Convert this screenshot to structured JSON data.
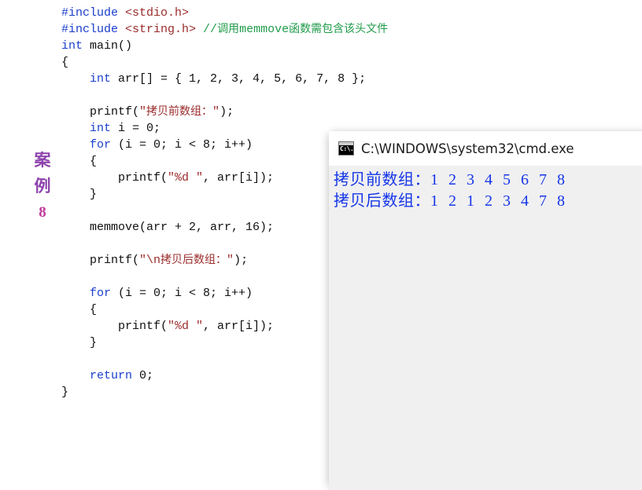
{
  "margin_caption": {
    "chars": [
      "案",
      "例"
    ],
    "number": "8",
    "char_color": "#8e44ad",
    "number_color": "#c0399b"
  },
  "code": {
    "language": "c",
    "lines": [
      [
        {
          "t": "#include ",
          "c": "pre"
        },
        {
          "t": "<stdio.h>",
          "c": "hdr"
        }
      ],
      [
        {
          "t": "#include ",
          "c": "pre"
        },
        {
          "t": "<string.h>",
          "c": "hdr"
        },
        {
          "t": " ",
          "c": "plain"
        },
        {
          "t": "//调用memmove函数需包含该头文件",
          "c": "cmt"
        }
      ],
      [
        {
          "t": "int",
          "c": "kw"
        },
        {
          "t": " main()",
          "c": "plain"
        }
      ],
      [
        {
          "t": "{",
          "c": "plain"
        }
      ],
      [
        {
          "t": "    ",
          "c": "plain"
        },
        {
          "t": "int",
          "c": "kw"
        },
        {
          "t": " arr[] = { 1, 2, 3, 4, 5, 6, 7, 8 };",
          "c": "plain"
        }
      ],
      [
        {
          "t": "",
          "c": "plain"
        }
      ],
      [
        {
          "t": "    printf(",
          "c": "plain"
        },
        {
          "t": "\"拷贝前数组：\"",
          "c": "str"
        },
        {
          "t": ");",
          "c": "plain"
        }
      ],
      [
        {
          "t": "    ",
          "c": "plain"
        },
        {
          "t": "int",
          "c": "kw"
        },
        {
          "t": " i = 0;",
          "c": "plain"
        }
      ],
      [
        {
          "t": "    ",
          "c": "plain"
        },
        {
          "t": "for",
          "c": "kw"
        },
        {
          "t": " (i = 0; i < 8; i++)",
          "c": "plain"
        }
      ],
      [
        {
          "t": "    {",
          "c": "plain"
        }
      ],
      [
        {
          "t": "        printf(",
          "c": "plain"
        },
        {
          "t": "\"%d \"",
          "c": "str"
        },
        {
          "t": ", arr[i]);",
          "c": "plain"
        }
      ],
      [
        {
          "t": "    }",
          "c": "plain"
        }
      ],
      [
        {
          "t": "",
          "c": "plain"
        }
      ],
      [
        {
          "t": "    memmove(arr + 2, arr, 16);",
          "c": "plain"
        }
      ],
      [
        {
          "t": "",
          "c": "plain"
        }
      ],
      [
        {
          "t": "    printf(",
          "c": "plain"
        },
        {
          "t": "\"\\n拷贝后数组：\"",
          "c": "str"
        },
        {
          "t": ");",
          "c": "plain"
        }
      ],
      [
        {
          "t": "",
          "c": "plain"
        }
      ],
      [
        {
          "t": "    ",
          "c": "plain"
        },
        {
          "t": "for",
          "c": "kw"
        },
        {
          "t": " (i = 0; i < 8; i++)",
          "c": "plain"
        }
      ],
      [
        {
          "t": "    {",
          "c": "plain"
        }
      ],
      [
        {
          "t": "        printf(",
          "c": "plain"
        },
        {
          "t": "\"%d \"",
          "c": "str"
        },
        {
          "t": ", arr[i]);",
          "c": "plain"
        }
      ],
      [
        {
          "t": "    }",
          "c": "plain"
        }
      ],
      [
        {
          "t": "",
          "c": "plain"
        }
      ],
      [
        {
          "t": "    ",
          "c": "plain"
        },
        {
          "t": "return",
          "c": "kw"
        },
        {
          "t": " 0;",
          "c": "plain"
        }
      ],
      [
        {
          "t": "}",
          "c": "plain"
        }
      ]
    ],
    "colors": {
      "preprocessor": "#1a3ecc",
      "keyword": "#1a3ecc",
      "header": "#9b2b2b",
      "string": "#9b2b2b",
      "comment": "#1f9b4a",
      "plain": "#101010"
    }
  },
  "console": {
    "icon": "cmd-icon",
    "icon_glyph": "C:\\.",
    "title": "C:\\WINDOWS\\system32\\cmd.exe",
    "text_color": "#1536e8",
    "background": "#f0f0f0",
    "titlebar_background": "#ffffff",
    "output_lines": [
      {
        "label": "拷贝前数组：",
        "values": "1 2 3 4 5 6 7 8"
      },
      {
        "label": "拷贝后数组：",
        "values": "1 2 1 2 3 4 7 8"
      }
    ]
  }
}
